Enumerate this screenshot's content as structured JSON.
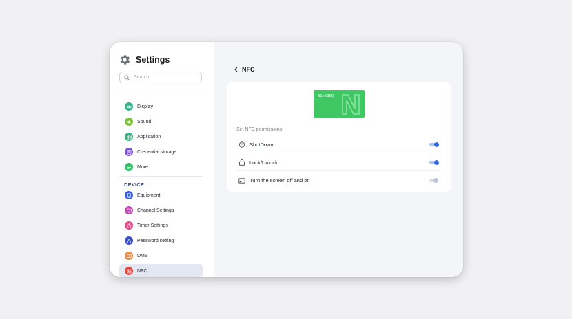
{
  "app": {
    "title": "Settings",
    "icon": "gear-icon"
  },
  "search": {
    "placeholder": "Search",
    "value": ""
  },
  "sidebar": {
    "items": [
      {
        "label": "Display",
        "icon": "eye-icon",
        "color": "#35b58a"
      },
      {
        "label": "Sound",
        "icon": "speaker-icon",
        "color": "#7cc23a"
      },
      {
        "label": "Application",
        "icon": "apps-grid-icon",
        "color": "#2fb47a"
      },
      {
        "label": "Credential storage",
        "icon": "credential-icon",
        "color": "#7b54d8"
      },
      {
        "label": "More",
        "icon": "more-list-icon",
        "color": "#3cbf6c"
      }
    ],
    "section_header": "DEVICE",
    "device_items": [
      {
        "label": "Equipment",
        "icon": "equipment-icon",
        "color": "#3d5fd6"
      },
      {
        "label": "Channel Settings",
        "icon": "channel-icon",
        "color": "#c247b5"
      },
      {
        "label": "Timer Settings",
        "icon": "timer-icon",
        "color": "#e04a88"
      },
      {
        "label": "Password setting",
        "icon": "lock-icon",
        "color": "#3a4fd0"
      },
      {
        "label": "DMS",
        "icon": "dms-icon",
        "color": "#ef8a3c"
      },
      {
        "label": "NFC",
        "icon": "nfc-icon",
        "color": "#e8483f",
        "active": true
      }
    ]
  },
  "page": {
    "title": "NFC",
    "back_icon": "chevron-left-icon"
  },
  "nfc_card": {
    "id": "81c5389",
    "color": "#3ec762",
    "icon": "nfc-logo-icon"
  },
  "permissions": {
    "title": "Set NFC permissions",
    "items": [
      {
        "label": "ShutDown",
        "icon": "power-timer-icon",
        "enabled": true
      },
      {
        "label": "Lock/Unlock",
        "icon": "lock-icon",
        "enabled": true
      },
      {
        "label": "Turn the screen off and on",
        "icon": "screen-off-icon",
        "enabled": false
      }
    ]
  },
  "colors": {
    "accent": "#2f6ee6",
    "sidebar_active": "#e3e7f1"
  }
}
